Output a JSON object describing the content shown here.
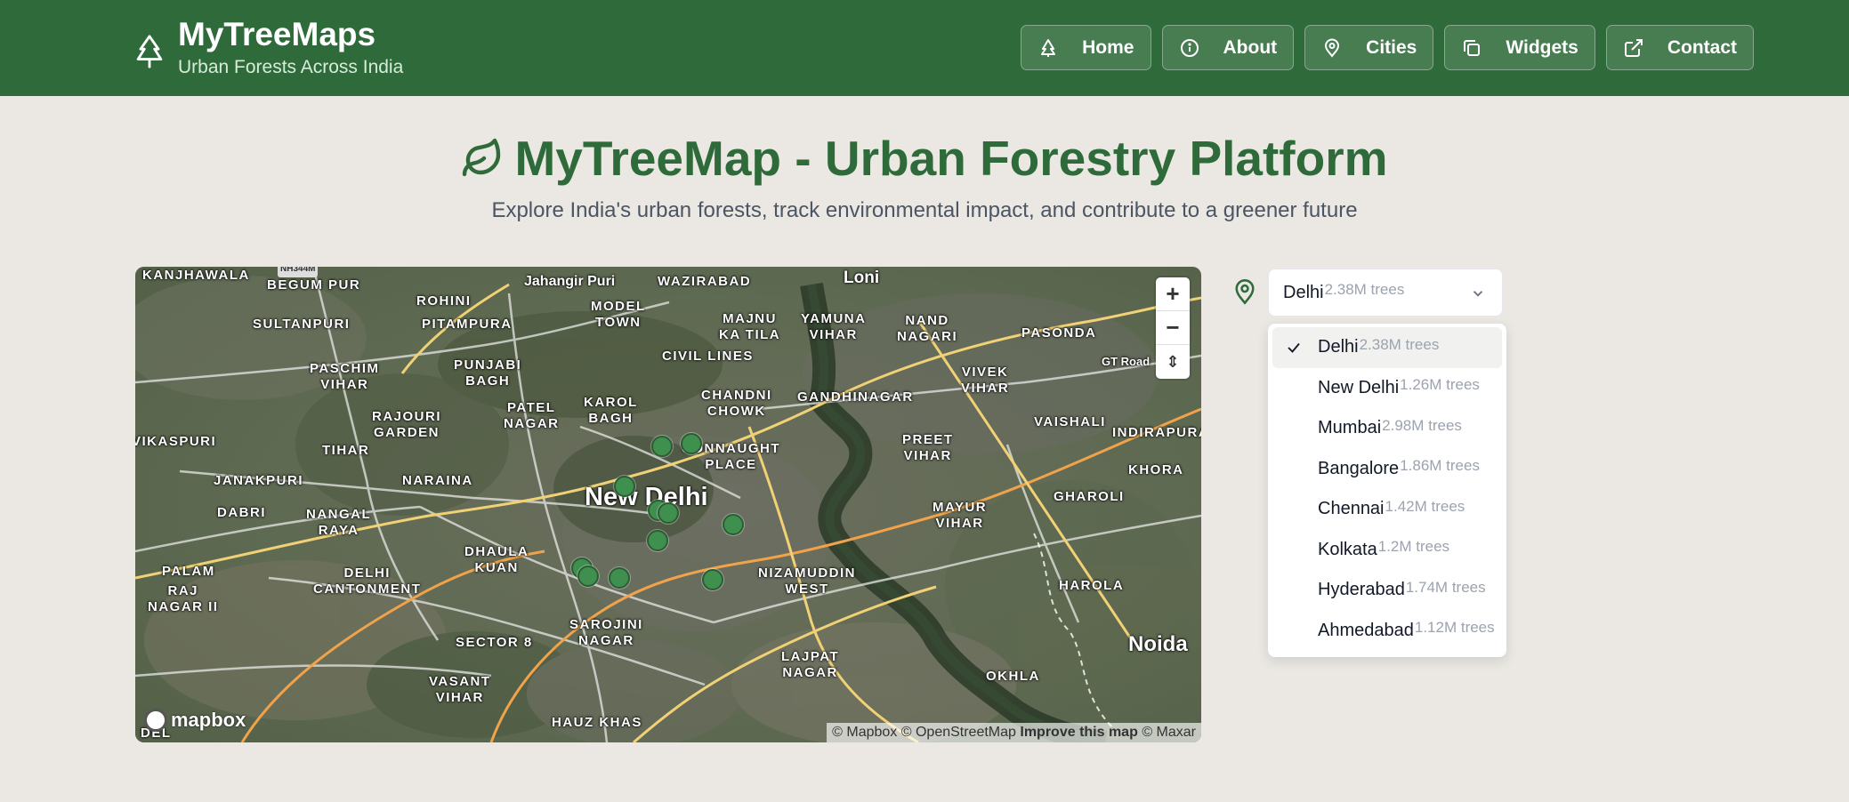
{
  "header": {
    "title": "MyTreeMaps",
    "subtitle": "Urban Forests Across India",
    "nav": [
      {
        "label": "Home",
        "icon": "tree-icon"
      },
      {
        "label": "About",
        "icon": "info-icon"
      },
      {
        "label": "Cities",
        "icon": "map-pin-icon"
      },
      {
        "label": "Widgets",
        "icon": "copy-icon"
      },
      {
        "label": "Contact",
        "icon": "external-link-icon"
      }
    ]
  },
  "hero": {
    "title": "MyTreeMap - Urban Forestry Platform",
    "subtitle": "Explore India's urban forests, track environmental impact, and contribute to a greener future"
  },
  "map": {
    "city_label": "New Delhi",
    "labels": [
      "KANJHAWALA",
      "BEGUM PUR",
      "ROHINI",
      "Jahangir Puri",
      "WAZIRABAD",
      "Loni",
      "SULTANPURI",
      "PITAMPURA",
      "MODEL\nTOWN",
      "MAJNU\nKA TILA",
      "YAMUNA\nVIHAR",
      "NAND\nNAGARI",
      "PASONDA",
      "PASCHIM\nVIHAR",
      "PUNJABI\nBAGH",
      "CIVIL LINES",
      "CHANDNI\nCHOWK",
      "GANDHINAGAR",
      "VIVEK\nVIHAR",
      "GT Road",
      "RAJOURI\nGARDEN",
      "PATEL\nNAGAR",
      "KAROL\nBAGH",
      "CONNAUGHT\nPLACE",
      "PREET\nVIHAR",
      "VAISHALI",
      "INDIRAPURA",
      "VIKASPURI",
      "TIHAR",
      "JANAKPURI",
      "NARAINA",
      "KHORA",
      "GHAROLI",
      "DABRI",
      "NANGAL\nRAYA",
      "MAYUR\nVIHAR",
      "DHAULA\nKUAN",
      "DELHI\nCANTONMENT",
      "NIZAMUDDIN\nWEST",
      "HAROLA",
      "PALAM",
      "RAJ\nNAGAR II",
      "SAROJINI\nNAGAR",
      "SECTOR 8",
      "LAJPAT\nNAGAR",
      "Noida",
      "OKHLA",
      "VASANT\nVIHAR",
      "HAUZ KHAS",
      "DEL",
      "NH344M"
    ],
    "zoom_in": "+",
    "zoom_out": "−",
    "compass": "⇕",
    "logo": "mapbox",
    "attribution": {
      "mapbox": "© Mapbox",
      "osm": "© OpenStreetMap",
      "improve": "Improve this map",
      "maxar": "© Maxar"
    }
  },
  "city_select": {
    "selected": {
      "name": "Delhi",
      "count": "2.38M trees"
    },
    "options": [
      {
        "name": "Delhi",
        "count": "2.38M trees"
      },
      {
        "name": "New Delhi",
        "count": "1.26M trees"
      },
      {
        "name": "Mumbai",
        "count": "2.98M trees"
      },
      {
        "name": "Bangalore",
        "count": "1.86M trees"
      },
      {
        "name": "Chennai",
        "count": "1.42M trees"
      },
      {
        "name": "Kolkata",
        "count": "1.2M trees"
      },
      {
        "name": "Hyderabad",
        "count": "1.74M trees"
      },
      {
        "name": "Ahmedabad",
        "count": "1.12M trees"
      }
    ]
  },
  "colors": {
    "header": "#2f6a3a",
    "accent": "#2f6a3a",
    "background": "#ebe8e3",
    "marker": "#3f8f4f"
  }
}
